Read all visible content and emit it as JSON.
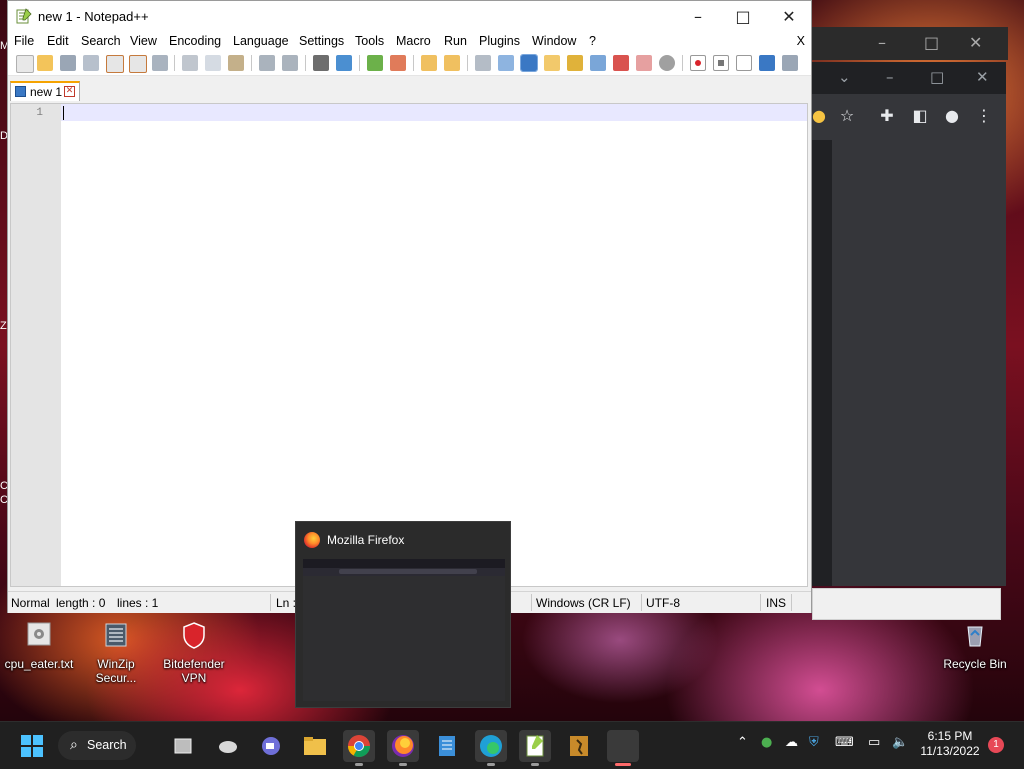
{
  "notepad": {
    "window_title": "new 1 - Notepad++",
    "menu": [
      "File",
      "Edit",
      "Search",
      "View",
      "Encoding",
      "Language",
      "Settings",
      "Tools",
      "Macro",
      "Run",
      "Plugins",
      "Window",
      "?"
    ],
    "menu_close": "X",
    "tab_label": "new 1",
    "line_number": "1",
    "status": {
      "mode": "Normal",
      "length": "length : 0",
      "lines": "lines : 1",
      "position": "Ln :",
      "eol": "Windows (CR LF)",
      "encoding": "UTF-8",
      "insert_mode": "INS"
    }
  },
  "firefox_preview": {
    "title": "Mozilla Firefox"
  },
  "desktop_icons": [
    {
      "label": "cpu_eater.txt"
    },
    {
      "label": "WinZip Secur..."
    },
    {
      "label": "Bitdefender VPN"
    },
    {
      "label": "Recycle Bin"
    }
  ],
  "taskbar": {
    "search_label": "Search",
    "time": "6:15 PM",
    "date": "11/13/2022",
    "notification_count": "1"
  },
  "colors": {
    "accent_tab": "#f5a300",
    "taskbar_bg": "#202020",
    "chrome_dark": "#35363a"
  }
}
